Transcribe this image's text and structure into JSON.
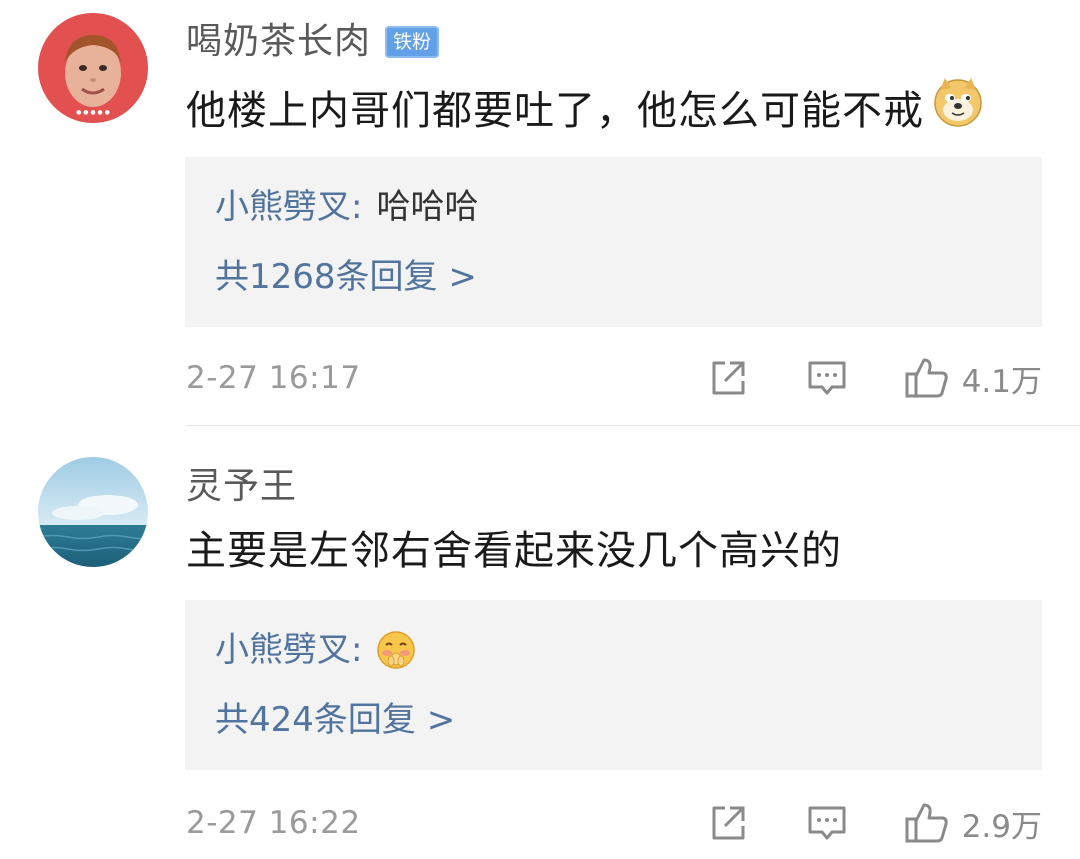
{
  "comments": [
    {
      "username": "喝奶茶长肉",
      "badge": "铁粉",
      "avatar_icon": "child-face-avatar",
      "text": "他楼上内哥们都要吐了，他怎么可能不戒",
      "text_emoji": "doge-emoji",
      "reply": {
        "author": "小熊劈叉:",
        "text": "哈哈哈",
        "emoji": "",
        "count_label": "共1268条回复 >"
      },
      "time": "2-27 16:17",
      "likes": "4.1万"
    },
    {
      "username": "灵予王",
      "badge": "",
      "avatar_icon": "sea-sky-avatar",
      "text": "主要是左邻右舍看起来没几个高兴的",
      "text_emoji": "",
      "reply": {
        "author": "小熊劈叉:",
        "text": "",
        "emoji": "shy-face-emoji",
        "count_label": "共424条回复 >"
      },
      "time": "2-27 16:22",
      "likes": "2.9万"
    }
  ],
  "colors": {
    "link_blue": "#51749e",
    "badge_blue": "#62a0e8",
    "reply_bg": "#f3f3f3",
    "meta_gray": "#9a9a9a"
  },
  "icons": [
    "share-icon",
    "comment-icon",
    "like-icon"
  ]
}
